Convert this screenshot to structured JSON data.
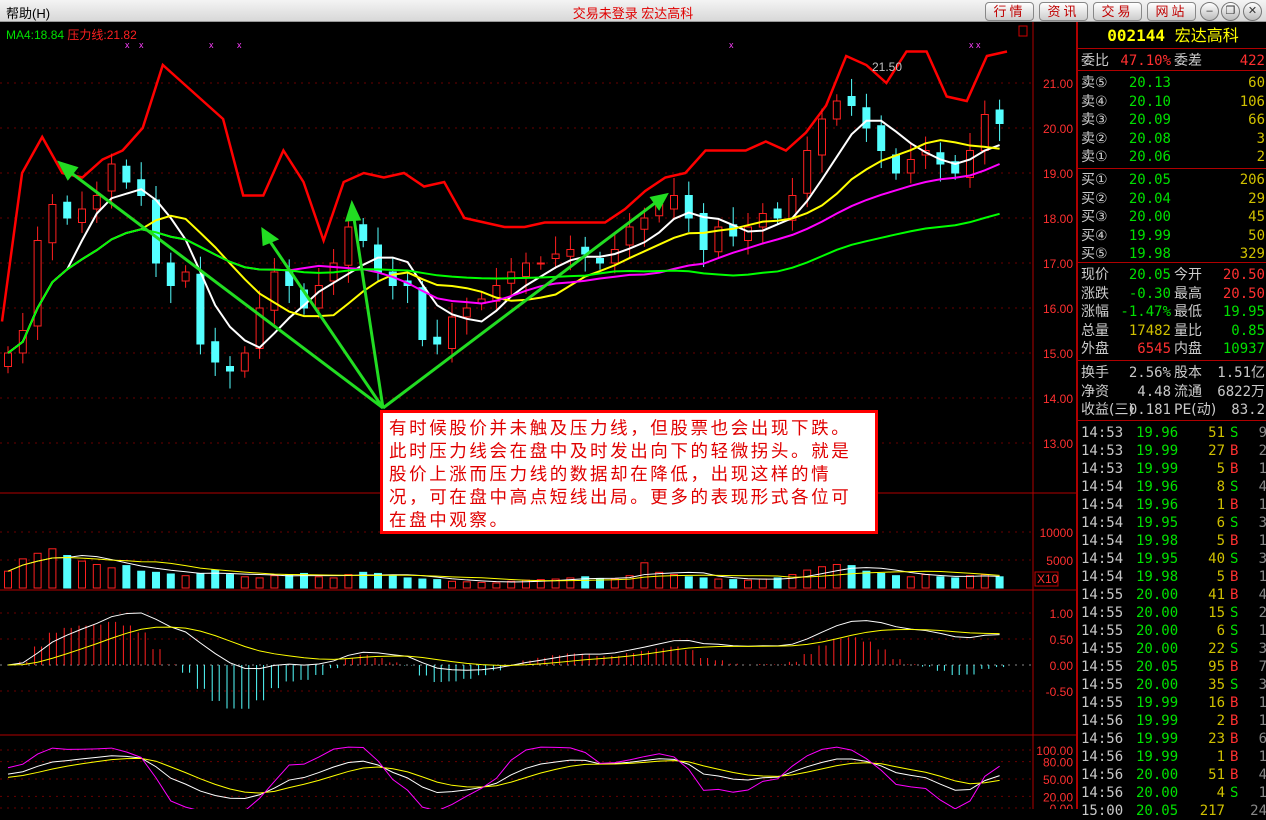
{
  "topbar": {
    "help": "帮助(H)",
    "title": "交易未登录 宏达高科",
    "buttons": [
      "行情",
      "资讯",
      "交易",
      "网站"
    ],
    "window": [
      "–",
      "❐",
      "✕"
    ]
  },
  "legend": {
    "ma": "MA4:18.84",
    "pressure": "压力线:21.82"
  },
  "chart_labels": {
    "high_mark": "21.50",
    "vol_unit": "X10"
  },
  "axes": {
    "price": [
      "21.00",
      "20.00",
      "19.00",
      "18.00",
      "17.00",
      "16.00",
      "15.00",
      "14.00",
      "13.00"
    ],
    "price_values": [
      21,
      20,
      19,
      18,
      17,
      16,
      15,
      14,
      13
    ],
    "volume": [
      "10000",
      "5000"
    ],
    "macd": [
      "1.00",
      "0.50",
      "0.00",
      "-0.50"
    ],
    "kdj": [
      "100.00",
      "80.00",
      "50.00",
      "20.00",
      "0.00"
    ]
  },
  "colors": {
    "up": "#ff2020",
    "down": "#54ffff",
    "ma5": "#ffffff",
    "ma10": "#ffff00",
    "ma20": "#ff00ff",
    "ma40": "#00ff00",
    "pressure": "#ff0000",
    "arrow": "#22dd22"
  },
  "chart_data": {
    "type": "candlestick",
    "closes": [
      15.0,
      15.5,
      17.5,
      18.3,
      18.0,
      18.2,
      18.5,
      19.2,
      18.8,
      18.5,
      17.0,
      16.5,
      16.8,
      15.2,
      14.8,
      14.6,
      15.0,
      16.0,
      16.8,
      16.5,
      16.0,
      16.5,
      17.0,
      17.8,
      17.5,
      16.8,
      16.5,
      16.5,
      15.3,
      15.2,
      15.8,
      16.0,
      16.2,
      16.5,
      16.8,
      17.0,
      17.0,
      17.2,
      17.3,
      17.2,
      17.0,
      17.3,
      17.8,
      18.0,
      18.3,
      18.5,
      18.0,
      17.3,
      17.8,
      17.6,
      17.8,
      18.1,
      18.0,
      18.5,
      19.5,
      20.2,
      20.6,
      20.5,
      20.0,
      19.5,
      19.0,
      19.3,
      19.5,
      19.2,
      19.0,
      19.5,
      20.3,
      20.1
    ],
    "volumes": [
      3000,
      5200,
      6200,
      7000,
      5800,
      4800,
      4200,
      3600,
      4000,
      3000,
      2800,
      2500,
      2200,
      2600,
      3200,
      2400,
      2000,
      1800,
      2200,
      2400,
      2600,
      2000,
      1800,
      2400,
      2800,
      2600,
      2200,
      1800,
      1600,
      1500,
      1200,
      1100,
      1000,
      900,
      1200,
      1400,
      1500,
      1600,
      1800,
      2000,
      1700,
      1600,
      2200,
      4500,
      2800,
      2400,
      2000,
      1800,
      1600,
      1500,
      1400,
      1600,
      1800,
      2400,
      3200,
      3800,
      4200,
      4000,
      3000,
      2600,
      2200,
      2000,
      2400,
      2000,
      1800,
      2200,
      2400,
      2000
    ],
    "pressure_line": [
      15.7,
      19.0,
      19.8,
      19.0,
      18.9,
      19.3,
      19.5,
      20.0,
      21.4,
      21.0,
      20.6,
      20.2,
      18.5,
      18.5,
      19.5,
      18.8,
      17.5,
      18.8,
      19.0,
      18.9,
      19.0,
      18.7,
      18.8,
      18.0,
      17.9,
      17.8,
      17.8,
      17.9,
      17.9,
      17.9,
      17.9,
      18.2,
      18.6,
      18.9,
      19.0,
      19.5,
      19.5,
      19.5,
      19.7,
      19.5,
      19.9,
      20.5,
      21.6,
      21.4,
      21.0,
      21.7,
      21.7,
      20.7,
      20.6,
      21.6,
      21.7
    ],
    "ma_periods": [
      5,
      10,
      20,
      40
    ],
    "ylim": [
      12.5,
      22
    ]
  },
  "quote": {
    "code": "002144",
    "name": "宏达高科",
    "wb": {
      "l1": "委比",
      "v1": "47.10%",
      "l2": "委差",
      "v2": "422"
    },
    "sell": [
      {
        "l": "卖⑤",
        "p": "20.13",
        "v": "60"
      },
      {
        "l": "卖④",
        "p": "20.10",
        "v": "106"
      },
      {
        "l": "卖③",
        "p": "20.09",
        "v": "66"
      },
      {
        "l": "卖②",
        "p": "20.08",
        "v": "3"
      },
      {
        "l": "卖①",
        "p": "20.06",
        "v": "2"
      }
    ],
    "buy": [
      {
        "l": "买①",
        "p": "20.05",
        "v": "206"
      },
      {
        "l": "买②",
        "p": "20.04",
        "v": "29"
      },
      {
        "l": "买③",
        "p": "20.00",
        "v": "45"
      },
      {
        "l": "买④",
        "p": "19.99",
        "v": "50"
      },
      {
        "l": "买⑤",
        "p": "19.98",
        "v": "329"
      }
    ],
    "stats": [
      {
        "l1": "现价",
        "v1": "20.05",
        "c1": "g",
        "l2": "今开",
        "v2": "20.50",
        "c2": "r"
      },
      {
        "l1": "涨跌",
        "v1": "-0.30",
        "c1": "g",
        "l2": "最高",
        "v2": "20.50",
        "c2": "r"
      },
      {
        "l1": "涨幅",
        "v1": "-1.47%",
        "c1": "g",
        "l2": "最低",
        "v2": "19.95",
        "c2": "g"
      },
      {
        "l1": "总量",
        "v1": "17482",
        "c1": "y",
        "l2": "量比",
        "v2": "0.85",
        "c2": "g"
      },
      {
        "l1": "外盘",
        "v1": "6545",
        "c1": "r",
        "l2": "内盘",
        "v2": "10937",
        "c2": "g"
      }
    ],
    "fund": [
      {
        "l1": "换手",
        "v1": "2.56%",
        "l2": "股本",
        "v2": "1.51亿"
      },
      {
        "l1": "净资",
        "v1": "4.48",
        "l2": "流通",
        "v2": "6822万"
      },
      {
        "l1": "收益(三)",
        "v1": "0.181",
        "l2": "PE(动)",
        "v2": "83.2"
      }
    ]
  },
  "trades": [
    [
      "14:53",
      "19.96",
      "51",
      "S",
      "9"
    ],
    [
      "14:53",
      "19.99",
      "27",
      "B",
      "2"
    ],
    [
      "14:53",
      "19.99",
      "5",
      "B",
      "1"
    ],
    [
      "14:54",
      "19.96",
      "8",
      "S",
      "4"
    ],
    [
      "14:54",
      "19.96",
      "1",
      "B",
      "1"
    ],
    [
      "14:54",
      "19.95",
      "6",
      "S",
      "3"
    ],
    [
      "14:54",
      "19.98",
      "5",
      "B",
      "1"
    ],
    [
      "14:54",
      "19.95",
      "40",
      "S",
      "3"
    ],
    [
      "14:54",
      "19.98",
      "5",
      "B",
      "1"
    ],
    [
      "14:55",
      "20.00",
      "41",
      "B",
      "4"
    ],
    [
      "14:55",
      "20.00",
      "15",
      "S",
      "2"
    ],
    [
      "14:55",
      "20.00",
      "6",
      "S",
      "1"
    ],
    [
      "14:55",
      "20.00",
      "22",
      "S",
      "3"
    ],
    [
      "14:55",
      "20.05",
      "95",
      "B",
      "7"
    ],
    [
      "14:55",
      "20.00",
      "35",
      "S",
      "3"
    ],
    [
      "14:55",
      "19.99",
      "16",
      "B",
      "1"
    ],
    [
      "14:56",
      "19.99",
      "2",
      "B",
      "1"
    ],
    [
      "14:56",
      "19.99",
      "23",
      "B",
      "6"
    ],
    [
      "14:56",
      "19.99",
      "1",
      "B",
      "1"
    ],
    [
      "14:56",
      "20.00",
      "51",
      "B",
      "4"
    ],
    [
      "14:56",
      "20.00",
      "4",
      "S",
      "1"
    ],
    [
      "15:00",
      "20.05",
      "217",
      "",
      "24"
    ]
  ],
  "note": "有时候股价并未触及压力线，但股票也会出现下跌。此时压力线会在盘中及时发出向下的轻微拐头。就是股价上涨而压力线的数据却在降低，出现这样的情况，可在盘中高点短线出局。更多的表现形式各位可在盘中观察。"
}
